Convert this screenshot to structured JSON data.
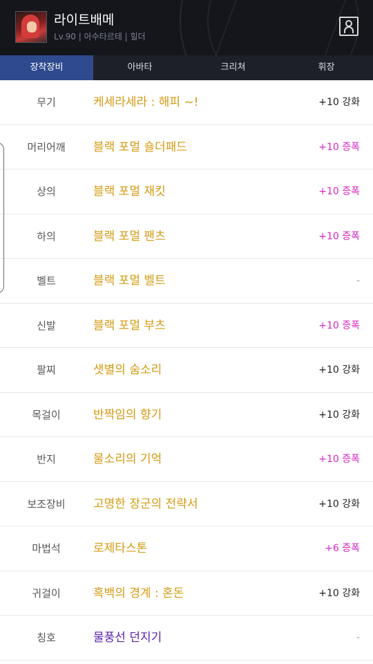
{
  "header": {
    "character_name": "라이트배메",
    "character_info": "Lv.90 | 아수타르테 | 힐더"
  },
  "tabs": [
    {
      "label": "장착장비"
    },
    {
      "label": "아바타"
    },
    {
      "label": "크리쳐"
    },
    {
      "label": "휘장"
    }
  ],
  "equipment": [
    {
      "slot": "무기",
      "item": "케세라세라 : 해피 ~!",
      "upgrade": "+10 강화"
    },
    {
      "slot": "머리어깨",
      "item": "블랙 포멀 숄더패드",
      "upgrade": "+10 증폭"
    },
    {
      "slot": "상의",
      "item": "블랙 포멀 재킷",
      "upgrade": "+10 증폭"
    },
    {
      "slot": "하의",
      "item": "블랙 포멀 팬츠",
      "upgrade": "+10 증폭"
    },
    {
      "slot": "벨트",
      "item": "블랙 포멀 벨트",
      "upgrade": "-"
    },
    {
      "slot": "신발",
      "item": "블랙 포멀 부츠",
      "upgrade": "+10 증폭"
    },
    {
      "slot": "팔찌",
      "item": "샛별의 숨소리",
      "upgrade": "+10 강화"
    },
    {
      "slot": "목걸이",
      "item": "반짝임의 향기",
      "upgrade": "+10 강화"
    },
    {
      "slot": "반지",
      "item": "물소리의 기억",
      "upgrade": "+10 증폭"
    },
    {
      "slot": "보조장비",
      "item": "고명한 장군의 전략서",
      "upgrade": "+10 강화"
    },
    {
      "slot": "마법석",
      "item": "로제타스톤",
      "upgrade": "+6 증폭"
    },
    {
      "slot": "귀걸이",
      "item": "흑백의 경계 : 혼돈",
      "upgrade": "+10 강화"
    },
    {
      "slot": "칭호",
      "item": "물풍선 던지기",
      "upgrade": "-"
    }
  ],
  "colors": {
    "header_bg": "#14161c",
    "tab_bg": "#1e2028",
    "tab_active": "#2f4a8e",
    "item_epic": "#d49a12",
    "item_unique": "#5a1fae",
    "amplify": "#d626c3"
  }
}
